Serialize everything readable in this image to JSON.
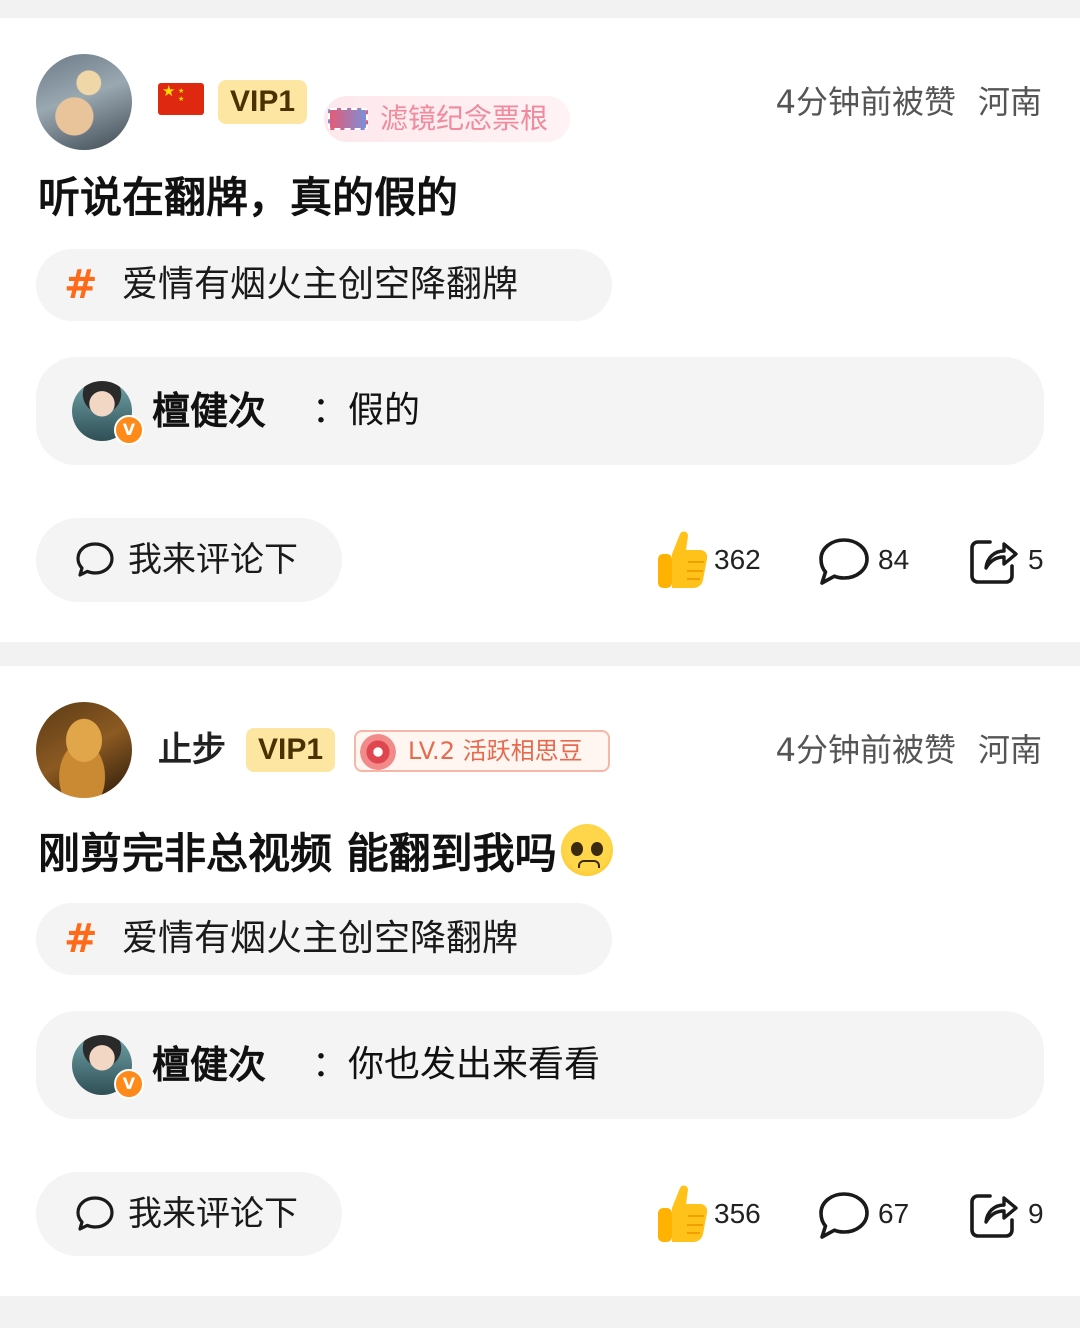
{
  "posts": [
    {
      "user": {
        "name": "",
        "vip": "VIP1",
        "badge": "滤镜纪念票根",
        "flag": "china-flag"
      },
      "meta": {
        "time": "4分钟前被赞",
        "location": "河南"
      },
      "content": "听说在翻牌，真的假的",
      "topic": {
        "hash": "#",
        "label": "爱情有烟火主创空降翻牌"
      },
      "reply": {
        "name": "檀健次",
        "sep": "：",
        "text": "假的"
      },
      "comment_button": "我来评论下",
      "stats": {
        "likes": "362",
        "comments": "84",
        "shares": "5"
      }
    },
    {
      "user": {
        "name": "止步",
        "vip": "VIP1",
        "badge": "LV.2 活跃相思豆"
      },
      "meta": {
        "time": "4分钟前被赞",
        "location": "河南"
      },
      "content": "刚剪完非总视频 能翻到我吗",
      "content_emoji": "pleading-face-emoji",
      "topic": {
        "hash": "#",
        "label": "爱情有烟火主创空降翻牌"
      },
      "reply": {
        "name": "檀健次",
        "sep": "：",
        "text": "你也发出来看看"
      },
      "comment_button": "我来评论下",
      "stats": {
        "likes": "356",
        "comments": "67",
        "shares": "9"
      }
    }
  ],
  "colors": {
    "accent": "#ff6a1a",
    "vip_bg": "#fde6a2",
    "bubble_bg": "#f4f4f4",
    "like_yellow": "#ffc21a",
    "verified": "#ff8a1a"
  }
}
